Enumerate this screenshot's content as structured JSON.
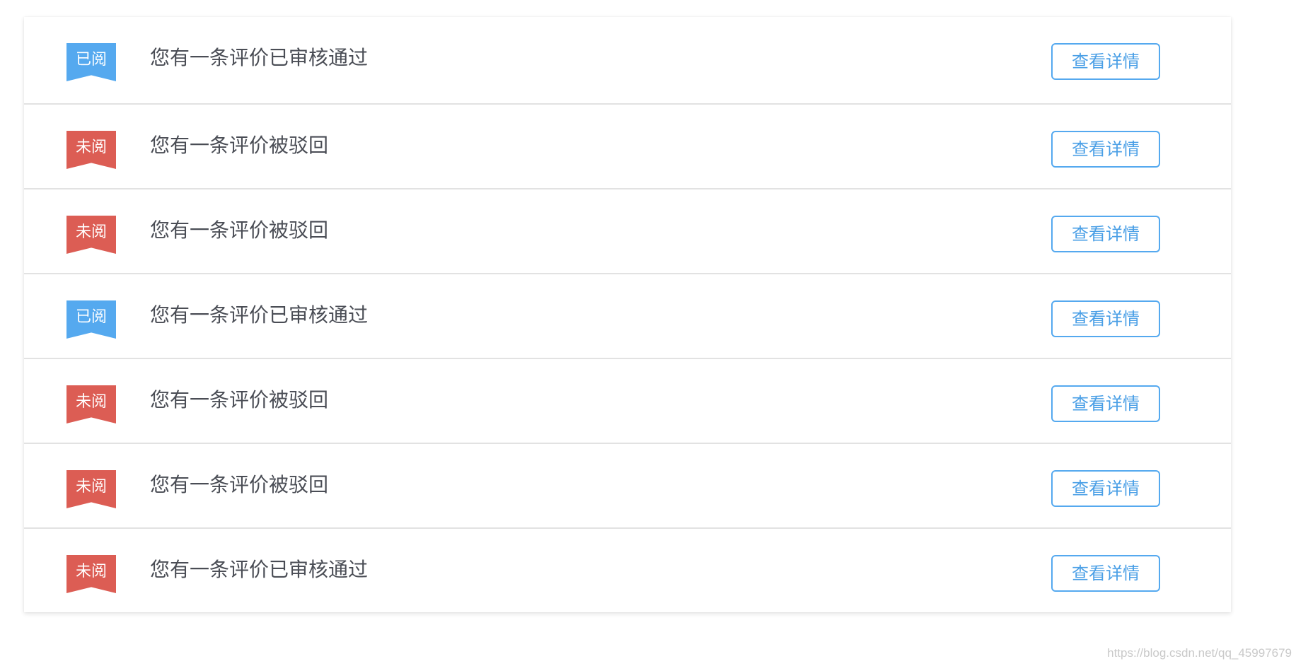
{
  "notifications": [
    {
      "status": "已阅",
      "status_type": "read",
      "message": "您有一条评价已审核通过",
      "action": "查看详情"
    },
    {
      "status": "未阅",
      "status_type": "unread",
      "message": "您有一条评价被驳回",
      "action": "查看详情"
    },
    {
      "status": "未阅",
      "status_type": "unread",
      "message": "您有一条评价被驳回",
      "action": "查看详情"
    },
    {
      "status": "已阅",
      "status_type": "read",
      "message": "您有一条评价已审核通过",
      "action": "查看详情"
    },
    {
      "status": "未阅",
      "status_type": "unread",
      "message": "您有一条评价被驳回",
      "action": "查看详情"
    },
    {
      "status": "未阅",
      "status_type": "unread",
      "message": "您有一条评价被驳回",
      "action": "查看详情"
    },
    {
      "status": "未阅",
      "status_type": "unread",
      "message": "您有一条评价已审核通过",
      "action": "查看详情"
    }
  ],
  "colors": {
    "read_badge": "#55a9ef",
    "unread_badge": "#dc5d54",
    "button_border": "#55a9ef",
    "button_text": "#4a9fe6",
    "message_text": "#4a4d55"
  },
  "watermark": "https://blog.csdn.net/qq_45997679"
}
